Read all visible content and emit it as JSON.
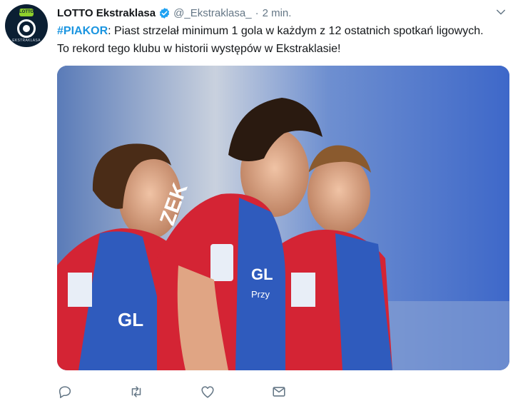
{
  "tweet": {
    "author": {
      "name": "LOTTO Ekstraklasa",
      "handle": "@_Ekstraklasa_",
      "avatar_badge": "LOTTO",
      "avatar_text": "EKSTRAKLASA",
      "verified": true
    },
    "separator": "·",
    "time": "2 min.",
    "hashtag": "#PIAKOR",
    "text": ": Piast strzelał minimum 1 gola w każdym z 12 ostatnich spotkań ligowych. To rekord tego klubu w historii występów w Ekstraklasie!",
    "media": {
      "shirt_text_center": "ZEK",
      "sponsor_text": "GL",
      "sponsor_sub": "Przy"
    },
    "actions": [
      "reply-icon",
      "retweet-icon",
      "like-icon",
      "message-icon"
    ]
  },
  "colors": {
    "link": "#1b95e0",
    "muted": "#657786",
    "verified": "#1da1f2",
    "jersey_red": "#d42434",
    "jersey_blue": "#2f5bbd"
  }
}
